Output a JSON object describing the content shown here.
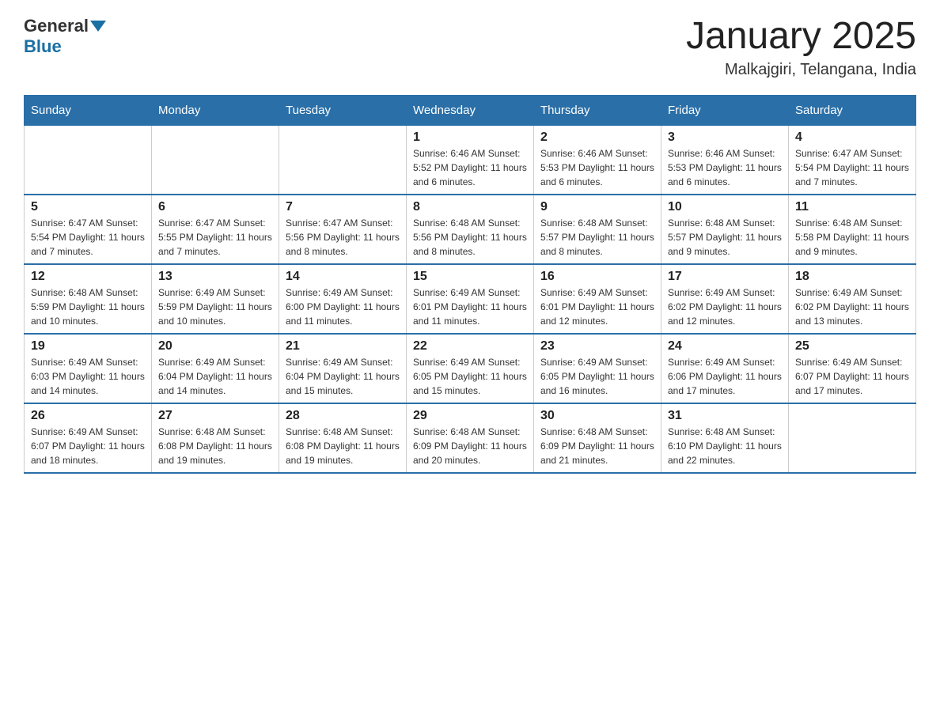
{
  "header": {
    "logo_general": "General",
    "logo_blue": "Blue",
    "month_title": "January 2025",
    "location": "Malkajgiri, Telangana, India"
  },
  "weekdays": [
    "Sunday",
    "Monday",
    "Tuesday",
    "Wednesday",
    "Thursday",
    "Friday",
    "Saturday"
  ],
  "rows": [
    [
      {
        "day": "",
        "info": ""
      },
      {
        "day": "",
        "info": ""
      },
      {
        "day": "",
        "info": ""
      },
      {
        "day": "1",
        "info": "Sunrise: 6:46 AM\nSunset: 5:52 PM\nDaylight: 11 hours and 6 minutes."
      },
      {
        "day": "2",
        "info": "Sunrise: 6:46 AM\nSunset: 5:53 PM\nDaylight: 11 hours and 6 minutes."
      },
      {
        "day": "3",
        "info": "Sunrise: 6:46 AM\nSunset: 5:53 PM\nDaylight: 11 hours and 6 minutes."
      },
      {
        "day": "4",
        "info": "Sunrise: 6:47 AM\nSunset: 5:54 PM\nDaylight: 11 hours and 7 minutes."
      }
    ],
    [
      {
        "day": "5",
        "info": "Sunrise: 6:47 AM\nSunset: 5:54 PM\nDaylight: 11 hours and 7 minutes."
      },
      {
        "day": "6",
        "info": "Sunrise: 6:47 AM\nSunset: 5:55 PM\nDaylight: 11 hours and 7 minutes."
      },
      {
        "day": "7",
        "info": "Sunrise: 6:47 AM\nSunset: 5:56 PM\nDaylight: 11 hours and 8 minutes."
      },
      {
        "day": "8",
        "info": "Sunrise: 6:48 AM\nSunset: 5:56 PM\nDaylight: 11 hours and 8 minutes."
      },
      {
        "day": "9",
        "info": "Sunrise: 6:48 AM\nSunset: 5:57 PM\nDaylight: 11 hours and 8 minutes."
      },
      {
        "day": "10",
        "info": "Sunrise: 6:48 AM\nSunset: 5:57 PM\nDaylight: 11 hours and 9 minutes."
      },
      {
        "day": "11",
        "info": "Sunrise: 6:48 AM\nSunset: 5:58 PM\nDaylight: 11 hours and 9 minutes."
      }
    ],
    [
      {
        "day": "12",
        "info": "Sunrise: 6:48 AM\nSunset: 5:59 PM\nDaylight: 11 hours and 10 minutes."
      },
      {
        "day": "13",
        "info": "Sunrise: 6:49 AM\nSunset: 5:59 PM\nDaylight: 11 hours and 10 minutes."
      },
      {
        "day": "14",
        "info": "Sunrise: 6:49 AM\nSunset: 6:00 PM\nDaylight: 11 hours and 11 minutes."
      },
      {
        "day": "15",
        "info": "Sunrise: 6:49 AM\nSunset: 6:01 PM\nDaylight: 11 hours and 11 minutes."
      },
      {
        "day": "16",
        "info": "Sunrise: 6:49 AM\nSunset: 6:01 PM\nDaylight: 11 hours and 12 minutes."
      },
      {
        "day": "17",
        "info": "Sunrise: 6:49 AM\nSunset: 6:02 PM\nDaylight: 11 hours and 12 minutes."
      },
      {
        "day": "18",
        "info": "Sunrise: 6:49 AM\nSunset: 6:02 PM\nDaylight: 11 hours and 13 minutes."
      }
    ],
    [
      {
        "day": "19",
        "info": "Sunrise: 6:49 AM\nSunset: 6:03 PM\nDaylight: 11 hours and 14 minutes."
      },
      {
        "day": "20",
        "info": "Sunrise: 6:49 AM\nSunset: 6:04 PM\nDaylight: 11 hours and 14 minutes."
      },
      {
        "day": "21",
        "info": "Sunrise: 6:49 AM\nSunset: 6:04 PM\nDaylight: 11 hours and 15 minutes."
      },
      {
        "day": "22",
        "info": "Sunrise: 6:49 AM\nSunset: 6:05 PM\nDaylight: 11 hours and 15 minutes."
      },
      {
        "day": "23",
        "info": "Sunrise: 6:49 AM\nSunset: 6:05 PM\nDaylight: 11 hours and 16 minutes."
      },
      {
        "day": "24",
        "info": "Sunrise: 6:49 AM\nSunset: 6:06 PM\nDaylight: 11 hours and 17 minutes."
      },
      {
        "day": "25",
        "info": "Sunrise: 6:49 AM\nSunset: 6:07 PM\nDaylight: 11 hours and 17 minutes."
      }
    ],
    [
      {
        "day": "26",
        "info": "Sunrise: 6:49 AM\nSunset: 6:07 PM\nDaylight: 11 hours and 18 minutes."
      },
      {
        "day": "27",
        "info": "Sunrise: 6:48 AM\nSunset: 6:08 PM\nDaylight: 11 hours and 19 minutes."
      },
      {
        "day": "28",
        "info": "Sunrise: 6:48 AM\nSunset: 6:08 PM\nDaylight: 11 hours and 19 minutes."
      },
      {
        "day": "29",
        "info": "Sunrise: 6:48 AM\nSunset: 6:09 PM\nDaylight: 11 hours and 20 minutes."
      },
      {
        "day": "30",
        "info": "Sunrise: 6:48 AM\nSunset: 6:09 PM\nDaylight: 11 hours and 21 minutes."
      },
      {
        "day": "31",
        "info": "Sunrise: 6:48 AM\nSunset: 6:10 PM\nDaylight: 11 hours and 22 minutes."
      },
      {
        "day": "",
        "info": ""
      }
    ]
  ]
}
